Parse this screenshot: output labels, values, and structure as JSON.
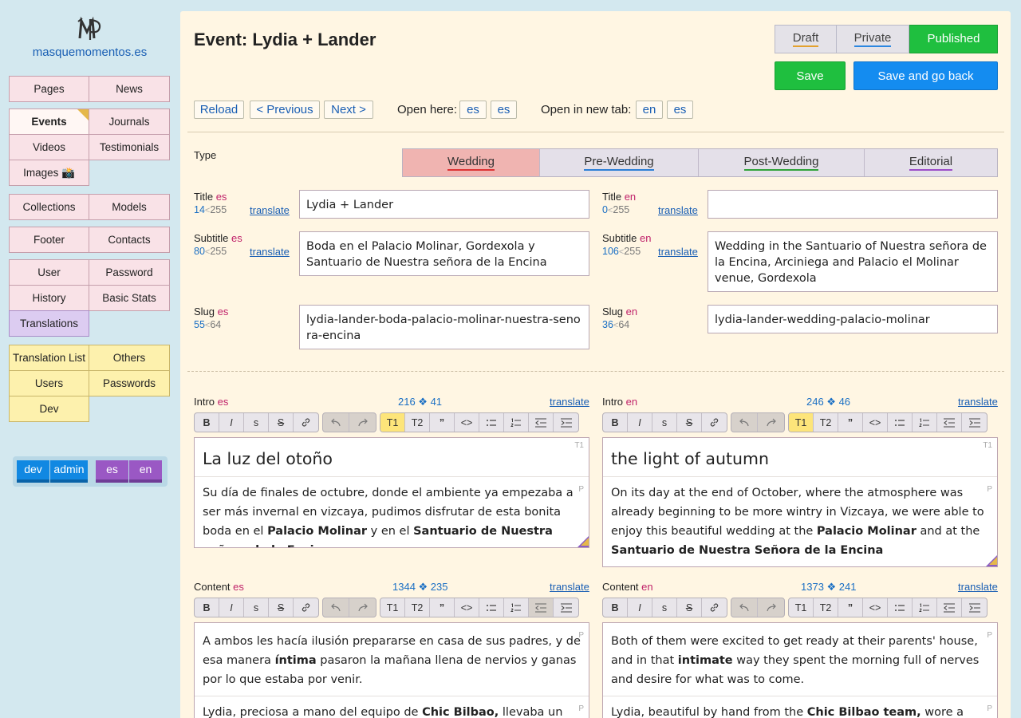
{
  "site": {
    "name": "masquemomentos.es",
    "logo_icon": "mp-monogram-logo"
  },
  "nav": {
    "pages": "Pages",
    "news": "News",
    "events": "Events",
    "journals": "Journals",
    "videos": "Videos",
    "testimonials": "Testimonials",
    "images": "Images 📸",
    "collections": "Collections",
    "models": "Models",
    "footer": "Footer",
    "contacts": "Contacts",
    "user": "User",
    "password": "Password",
    "history": "History",
    "basic_stats": "Basic Stats",
    "translations": "Translations",
    "translation_list": "Translation List",
    "others": "Others",
    "users": "Users",
    "passwords": "Passwords",
    "dev": "Dev"
  },
  "chips": {
    "dev": "dev",
    "admin": "admin",
    "es": "es",
    "en": "en"
  },
  "header": {
    "title": "Event: Lydia + Lander",
    "status": {
      "draft": "Draft",
      "private": "Private",
      "published": "Published",
      "selected": "Published"
    },
    "save": "Save",
    "save_back": "Save and go back",
    "reload": "Reload",
    "previous": "< Previous",
    "next": "Next >",
    "open_here": "Open here:",
    "open_new_tab": "Open in new tab:",
    "lang_es": "es",
    "lang_en": "en"
  },
  "type": {
    "label": "Type",
    "options": [
      "Wedding",
      "Pre-Wedding",
      "Post-Wedding",
      "Editorial"
    ],
    "selected": "Wedding"
  },
  "fields": {
    "translate": "translate",
    "max_sep": "<",
    "title_es": {
      "label": "Title",
      "lang": "es",
      "count": "14",
      "max": "255",
      "value": "Lydia + Lander"
    },
    "title_en": {
      "label": "Title",
      "lang": "en",
      "count": "0",
      "max": "255",
      "value": ""
    },
    "subtitle_es": {
      "label": "Subtitle",
      "lang": "es",
      "count": "80",
      "max": "255",
      "value": "Boda en el Palacio Molinar, Gordexola y Santuario de Nuestra señora de la Encina"
    },
    "subtitle_en": {
      "label": "Subtitle",
      "lang": "en",
      "count": "106",
      "max": "255",
      "value": "Wedding in the Santuario of Nuestra señora de la Encina, Arciniega and Palacio el Molinar venue, Gordexola"
    },
    "slug_es": {
      "label": "Slug",
      "lang": "es",
      "count": "55",
      "max": "64",
      "value": "lydia-lander-boda-palacio-molinar-nuestra-senora-encina"
    },
    "slug_en": {
      "label": "Slug",
      "lang": "en",
      "count": "36",
      "max": "64",
      "value": "lydia-lander-wedding-palacio-molinar"
    }
  },
  "toolbar": {
    "bold": "B",
    "italic": "I",
    "small": "s",
    "strike": "S",
    "t1": "T1",
    "t2": "T2",
    "quote": "”",
    "code": "<>",
    "icons": [
      "link-icon",
      "undo-icon",
      "redo-icon",
      "bullet-list-icon",
      "numbered-list-icon",
      "outdent-icon",
      "indent-icon"
    ]
  },
  "intro_es": {
    "label": "Intro",
    "lang": "es",
    "counter": "216 ❖ 41",
    "heading": "La luz del otoño",
    "tag_h": "T1",
    "tag_p": "P",
    "p_1": "Su día de finales de octubre, donde el ambiente ya empezaba a ser más invernal en vizcaya, pudimos disfrutar de esta bonita boda en el ",
    "p_b1": "Palacio Molinar",
    "p_2": " y en el ",
    "p_b2": "Santuario de Nuestra señora de la Encina"
  },
  "intro_en": {
    "label": "Intro",
    "lang": "en",
    "counter": "246 ❖ 46",
    "heading": "the light of autumn",
    "tag_h": "T1",
    "tag_p": "P",
    "p_1": "On its day at the end of October, where the atmosphere was already beginning to be more wintry in Vizcaya, we were able to enjoy this beautiful wedding at the ",
    "p_b1": "Palacio Molinar",
    "p_2": " and at the ",
    "p_b2": "Santuario de Nuestra Señora de la Encina"
  },
  "content_es": {
    "label": "Content",
    "lang": "es",
    "counter": "1344 ❖ 235",
    "tag_p": "P",
    "p1_1": "A ambos les hacía ilusión prepararse en casa de sus padres, y de esa manera ",
    "p1_b": "íntima",
    "p1_2": " pasaron la mañana llena de nervios y ganas por lo que estaba por venir.",
    "p2_1": "Lydia, preciosa a mano del equipo de ",
    "p2_b": "Chic Bilbao,",
    "p2_2": " llevaba un semi"
  },
  "content_en": {
    "label": "Content",
    "lang": "en",
    "counter": "1373 ❖ 241",
    "tag_p": "P",
    "p1_1": "Both of them were excited to get ready at their parents' house, and in that ",
    "p1_b": "intimate",
    "p1_2": " way they spent the morning full of nerves and desire for what was to come.",
    "p2_1": "Lydia, beautiful by hand from the ",
    "p2_b": "Chic Bilbao team,",
    "p2_2": " wore a semi-"
  }
}
